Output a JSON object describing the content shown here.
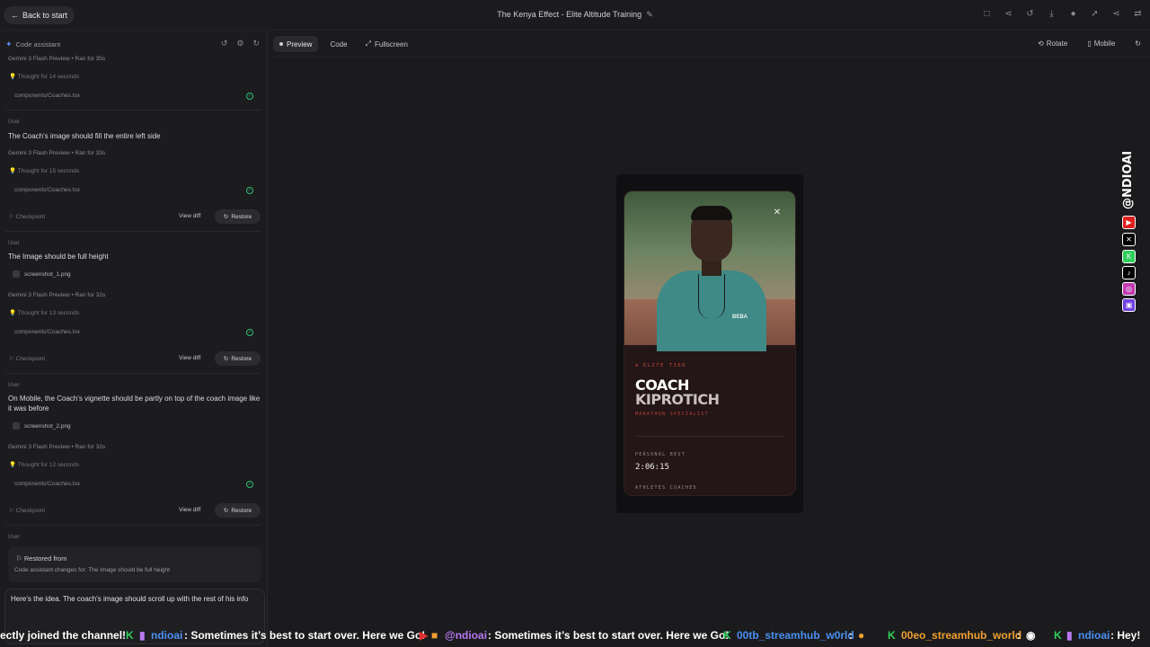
{
  "topbar": {
    "back_label": "Back to start",
    "title": "The Kenya Effect - Elite Altitude Training"
  },
  "sidebar": {
    "header": "Code assistant",
    "turns": [
      {
        "model": "Gemini 3 Flash Preview",
        "ran": "Ran for 35s",
        "thought": "Thought for 14 seconds",
        "file": "components/Coaches.tsx"
      },
      {
        "user_label": "User",
        "message": "The Coach's image should fill the entire left side",
        "model": "Gemini 3 Flash Preview",
        "ran": "Ran for 33s",
        "thought": "Thought for 15 seconds",
        "file": "components/Coaches.tsx",
        "checkpoint": "Checkpoint",
        "view_diff": "View diff",
        "restore": "Restore"
      },
      {
        "user_label": "User",
        "message": "The Image should be full height",
        "attachment": "screenshot_1.png",
        "model": "Gemini 3 Flash Preview",
        "ran": "Ran for 32s",
        "thought": "Thought for 13 seconds",
        "file": "components/Coaches.tsx",
        "checkpoint": "Checkpoint",
        "view_diff": "View diff",
        "restore": "Restore"
      },
      {
        "user_label": "User",
        "message": "On Mobile, the Coach's vignette should be partly on top of the coach image like it was before",
        "attachment": "screenshot_2.png",
        "model": "Gemini 3 Flash Preview",
        "ran": "Ran for 32s",
        "thought": "Thought for 12 seconds",
        "file": "components/Coaches.tsx",
        "checkpoint": "Checkpoint",
        "view_diff": "View diff",
        "restore": "Restore"
      }
    ],
    "last_user_label": "User",
    "restored_title": "Restored from",
    "restored_detail": "Code assistant changes for: The Image should be full height",
    "input_text": "Here's the idea. The coach's image should scroll up with the rest of his info"
  },
  "preview_tabs": {
    "preview": "Preview",
    "code": "Code",
    "fullscreen": "Fullscreen"
  },
  "preview_tools": {
    "rotate": "Rotate",
    "mobile": "Mobile"
  },
  "card": {
    "tier": "ELITE TIER",
    "name_line1": "COACH",
    "name_line2": "KIPROTICH",
    "specialty": "MARATHON SPECIALIST",
    "pb_label": "PERSONAL BEST",
    "pb_value": "2:06:15",
    "athletes_label": "ATHLETES COACHED",
    "shirt_logo": "BEBA"
  },
  "overlay": {
    "handle": "@NDIOAI"
  },
  "ticker": {
    "seg1": "ectly joined the channel!",
    "user1": "ndioai",
    "msg1": ": Sometimes it’s best to start over. Here we Go!",
    "user2": "@ndioai",
    "msg2": ": Sometimes it’s best to start over. Here we Go!",
    "user3": "00tb_streamhub_w0rld",
    "sep3": ":",
    "user4": "00eo_streamhub_world",
    "sep4": ":",
    "user5": "ndioai",
    "msg5": ": Hey!"
  },
  "colors": {
    "accent_red": "#c2463a",
    "check_green": "#2fbf71",
    "spark_blue": "#5b8cf5"
  }
}
